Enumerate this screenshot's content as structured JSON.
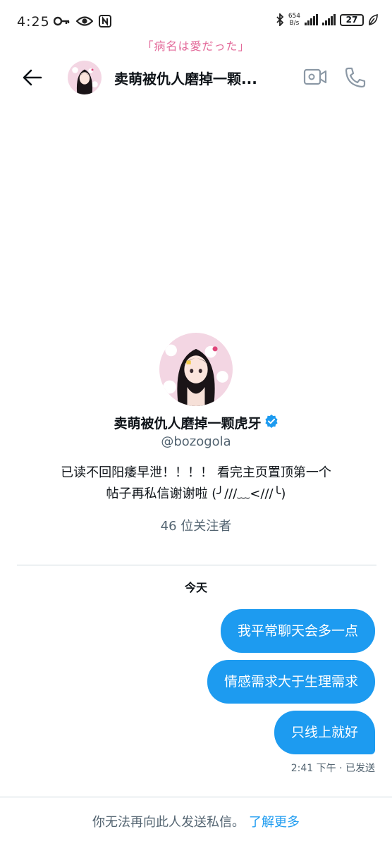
{
  "status_bar": {
    "time": "4:25",
    "net_speed_value": "654",
    "net_speed_unit": "B/s",
    "battery": "27"
  },
  "overlay_tag": "「病名は愛だった」",
  "header": {
    "title": "卖萌被仇人磨掉一颗..."
  },
  "profile": {
    "name": "卖萌被仇人磨掉一颗虎牙",
    "handle": "@bozogola",
    "bio_line1": "已读不回阳痿早泄！！！！ 看完主页置顶第一个",
    "bio_line2": "帖子再私信谢谢啦 (╯///﹏<///╰)",
    "followers": "46 位关注者"
  },
  "conversation": {
    "date_label": "今天",
    "messages": [
      {
        "text": "我平常聊天会多一点"
      },
      {
        "text": "情感需求大于生理需求"
      },
      {
        "text": "只线上就好"
      }
    ],
    "meta": "2:41 下午 · 已发送"
  },
  "footer": {
    "notice": "你无法再向此人发送私信。",
    "link": "了解更多"
  },
  "colors": {
    "accent": "#1d9bf0",
    "secondary_text": "#536471",
    "overlay_pink": "#e36a9a"
  }
}
